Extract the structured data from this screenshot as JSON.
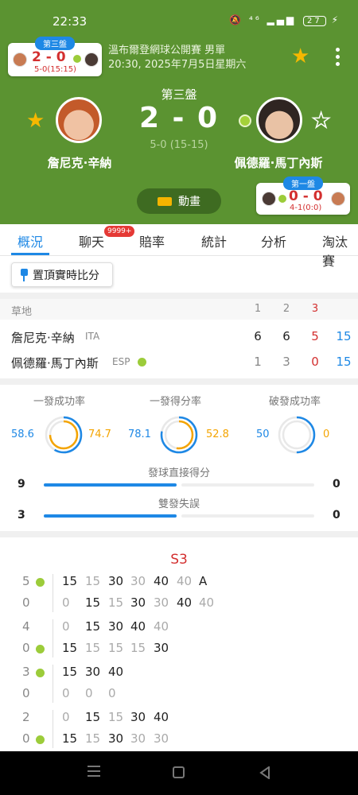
{
  "status_bar": {
    "time": "22:33",
    "icons": "🔕 ⁴⁶ ▂▄▆",
    "battery": "27",
    "charging_icon": "⚡"
  },
  "mini_card_left": {
    "label": "第三盤",
    "score": "2 - 0",
    "sub": "5-0(15:15)"
  },
  "mini_card_right": {
    "label": "第一盤",
    "score": "0 - 0",
    "sub": "4-1(0:0)"
  },
  "match": {
    "title": "溫布爾登網球公開賽 男單",
    "datetime": "20:30, 2025年7月5日星期六",
    "set_label": "第三盤",
    "score": "2 - 0",
    "game_score": "5-0 (15-15)"
  },
  "players": {
    "p1": "詹尼克·辛納",
    "p2": "佩德羅·馬丁內斯"
  },
  "animation_button": "動畫",
  "tabs": [
    "概況",
    "聊天",
    "賠率",
    "統計",
    "分析",
    "淘汰賽"
  ],
  "chat_badge": "9999+",
  "pin_button": "置頂實時比分",
  "scoreboard": {
    "surface": "草地",
    "set_headers": [
      "1",
      "2",
      "3"
    ],
    "rows": [
      {
        "name": "詹尼克·辛納",
        "country": "ITA",
        "sets": [
          "6",
          "6",
          "5"
        ],
        "total": "15"
      },
      {
        "name": "佩德羅·馬丁內斯",
        "country": "ESP",
        "sets": [
          "1",
          "3",
          "0"
        ],
        "total": "15"
      }
    ]
  },
  "stats": {
    "circles": [
      {
        "label": "一發成功率",
        "p1": "58.6",
        "p2": "74.7",
        "p1_frac": 0.586,
        "p2_frac": 0.747
      },
      {
        "label": "一發得分率",
        "p1": "78.1",
        "p2": "52.8",
        "p1_frac": 0.781,
        "p2_frac": 0.528
      },
      {
        "label": "破發成功率",
        "p1": "50",
        "p2": "0",
        "p1_frac": 0.5,
        "p2_frac": 0.0
      }
    ],
    "bars": [
      {
        "label": "發球直接得分",
        "p1": "9",
        "p2": "0",
        "p1_frac": 1.0,
        "p2_frac": 0.0
      },
      {
        "label": "雙發失誤",
        "p1": "3",
        "p2": "0",
        "p1_frac": 1.0,
        "p2_frac": 0.0
      }
    ]
  },
  "pbp": {
    "set_title": "S3",
    "games": [
      {
        "top_score": "5",
        "bot_score": "0",
        "server": "top",
        "top": [
          "15",
          "15",
          "30",
          "30",
          "40",
          "40",
          "A"
        ],
        "bot": [
          "0",
          "15",
          "15",
          "30",
          "30",
          "40",
          "40"
        ]
      },
      {
        "top_score": "4",
        "bot_score": "0",
        "server": "bot",
        "top": [
          "0",
          "15",
          "30",
          "40",
          "40"
        ],
        "bot": [
          "15",
          "15",
          "15",
          "15",
          "30"
        ]
      },
      {
        "top_score": "3",
        "bot_score": "0",
        "server": "top",
        "top": [
          "15",
          "30",
          "40"
        ],
        "bot": [
          "0",
          "0",
          "0"
        ]
      },
      {
        "top_score": "2",
        "bot_score": "0",
        "server": "bot",
        "top": [
          "0",
          "15",
          "15",
          "30",
          "40"
        ],
        "bot": [
          "15",
          "15",
          "30",
          "30",
          "30"
        ]
      }
    ]
  },
  "colors": {
    "header": "#5b9331",
    "accent": "#1e88e5",
    "p2_stat": "#f4a400",
    "score_red": "#d32f2f"
  }
}
